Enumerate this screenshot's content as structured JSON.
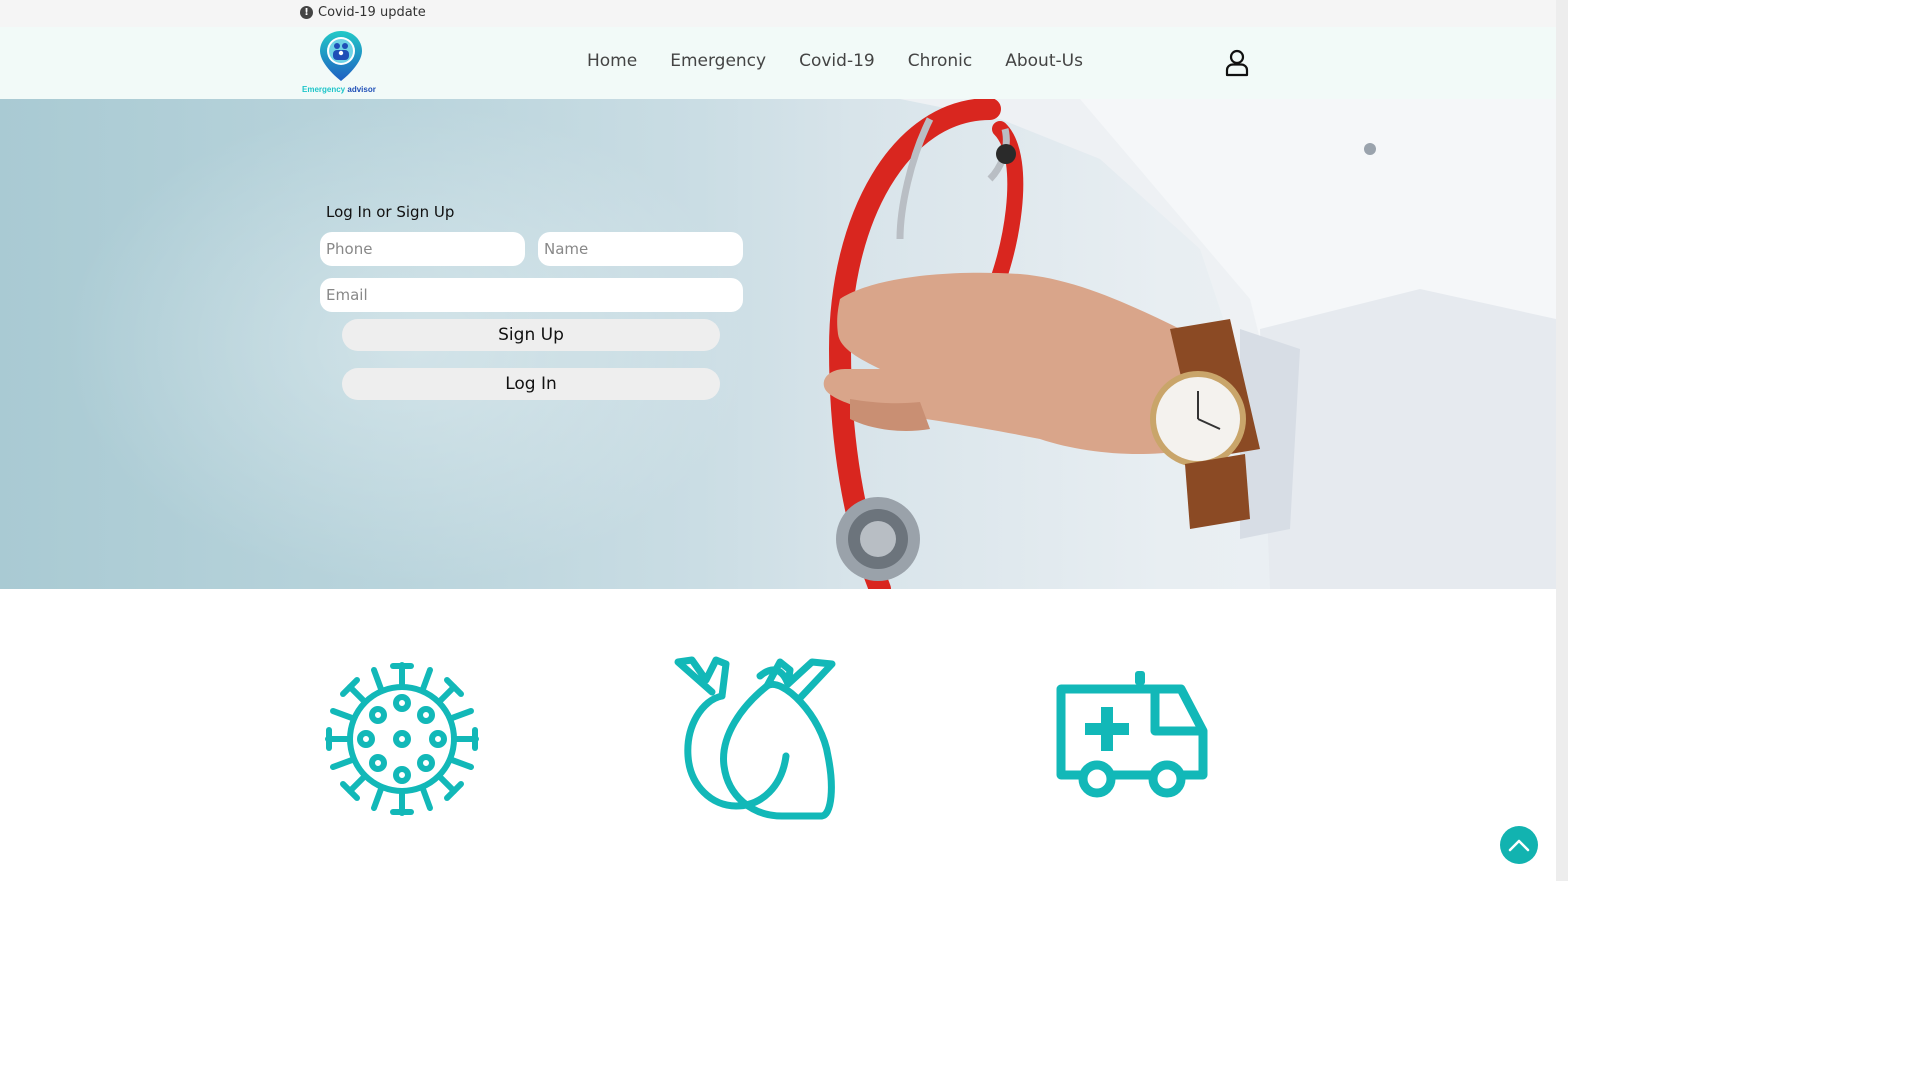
{
  "topbar": {
    "alert_icon": "!",
    "alert_text": "Covid-19 update"
  },
  "logo": {
    "icon": "location-pin-family-icon",
    "text_part1": "Emergency",
    "text_part2": "advisor"
  },
  "nav": {
    "items": [
      {
        "label": "Home"
      },
      {
        "label": "Emergency"
      },
      {
        "label": "Covid-19"
      },
      {
        "label": "Chronic"
      },
      {
        "label": "About-Us"
      }
    ]
  },
  "user": {
    "icon": "user-icon"
  },
  "login": {
    "title": "Log In or Sign Up",
    "phone_placeholder": "Phone",
    "name_placeholder": "Name",
    "email_placeholder": "Email",
    "signup_label": "Sign Up",
    "login_label": "Log In"
  },
  "features": [
    {
      "icon": "virus-icon"
    },
    {
      "icon": "heart-organ-icon"
    },
    {
      "icon": "ambulance-icon"
    }
  ],
  "colors": {
    "accent": "#12b8b8",
    "navbar_bg": "#f2faf8",
    "topbar_bg": "#f5f5f5"
  },
  "scroll_top": {
    "icon": "chevron-up-icon"
  }
}
